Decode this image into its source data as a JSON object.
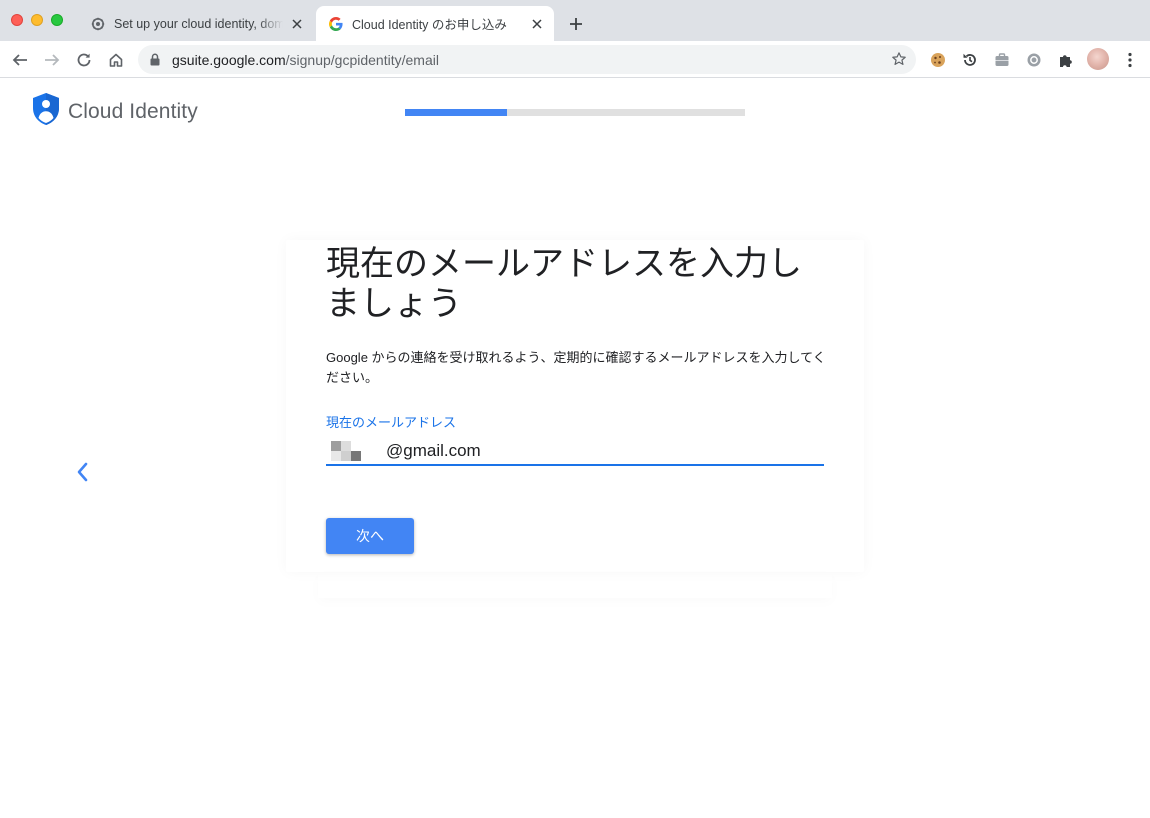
{
  "browser": {
    "tabs": [
      {
        "title": "Set up your cloud identity, domain",
        "favicon": "chrome-gear-icon",
        "active": false
      },
      {
        "title": "Cloud Identity のお申し込み",
        "favicon": "google-g-icon",
        "active": true
      }
    ],
    "url_host": "gsuite.google.com",
    "url_path": "/signup/gcpidentity/email",
    "extensions": [
      "cookie-icon",
      "history-icon",
      "briefcase-icon",
      "circle-r-icon",
      "puzzle-icon"
    ]
  },
  "page": {
    "brand": "Cloud Identity",
    "progress_fraction": 0.3,
    "heading": "現在のメールアドレスを入力しましょう",
    "description": "Google からの連絡を受け取れるよう、定期的に確認するメールアドレスを入力してください。",
    "email_label": "現在のメールアドレス",
    "email_value": "@gmail.com",
    "next_button": "次へ"
  },
  "colors": {
    "accent": "#4285f4",
    "link_blue": "#1a73e8",
    "shield_blue": "#1a73e8"
  }
}
